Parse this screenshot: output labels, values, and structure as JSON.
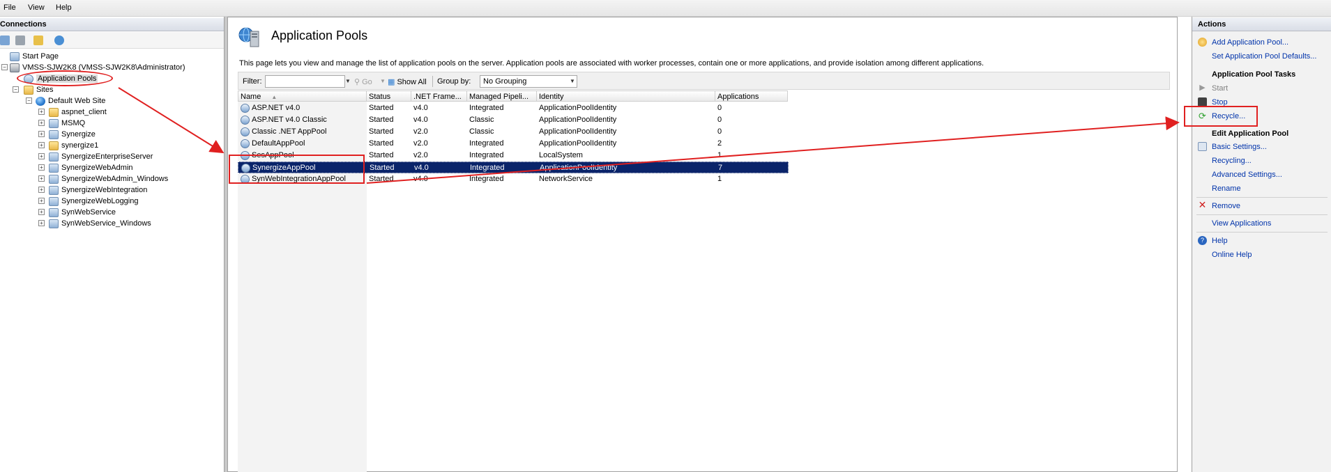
{
  "menubar": {
    "items": [
      "File",
      "View",
      "Help"
    ]
  },
  "connections": {
    "header": "Connections",
    "tree": {
      "start_page": "Start Page",
      "server": "VMSS-SJW2K8 (VMSS-SJW2K8\\Administrator)",
      "application_pools": "Application Pools",
      "sites": "Sites",
      "default_web_site": "Default Web Site",
      "children": [
        "aspnet_client",
        "MSMQ",
        "Synergize",
        "synergize1",
        "SynergizeEnterpriseServer",
        "SynergizeWebAdmin",
        "SynergizeWebAdmin_Windows",
        "SynergizeWebIntegration",
        "SynergizeWebLogging",
        "SynWebService",
        "SynWebService_Windows"
      ]
    }
  },
  "main": {
    "title": "Application Pools",
    "description": "This page lets you view and manage the list of application pools on the server. Application pools are associated with worker processes, contain one or more applications, and provide isolation among different applications.",
    "filter": {
      "label": "Filter:",
      "value": "",
      "go_label": "Go",
      "show_all_label": "Show All",
      "group_by_label": "Group by:",
      "group_by_value": "No Grouping"
    },
    "columns": [
      "Name",
      "Status",
      ".NET Frame...",
      "Managed Pipeli...",
      "Identity",
      "Applications"
    ],
    "rows": [
      {
        "name": "ASP.NET v4.0",
        "status": "Started",
        "net": "v4.0",
        "pipeline": "Integrated",
        "identity": "ApplicationPoolIdentity",
        "apps": "0"
      },
      {
        "name": "ASP.NET v4.0 Classic",
        "status": "Started",
        "net": "v4.0",
        "pipeline": "Classic",
        "identity": "ApplicationPoolIdentity",
        "apps": "0"
      },
      {
        "name": "Classic .NET AppPool",
        "status": "Started",
        "net": "v2.0",
        "pipeline": "Classic",
        "identity": "ApplicationPoolIdentity",
        "apps": "0"
      },
      {
        "name": "DefaultAppPool",
        "status": "Started",
        "net": "v2.0",
        "pipeline": "Integrated",
        "identity": "ApplicationPoolIdentity",
        "apps": "2"
      },
      {
        "name": "SesAppPool",
        "status": "Started",
        "net": "v2.0",
        "pipeline": "Integrated",
        "identity": "LocalSystem",
        "apps": "1"
      },
      {
        "name": "SynergizeAppPool",
        "status": "Started",
        "net": "v4.0",
        "pipeline": "Integrated",
        "identity": "ApplicationPoolIdentity",
        "apps": "7",
        "selected": true
      },
      {
        "name": "SynWebIntegrationAppPool",
        "status": "Started",
        "net": "v4.0",
        "pipeline": "Integrated",
        "identity": "NetworkService",
        "apps": "1"
      }
    ]
  },
  "actions": {
    "header": "Actions",
    "add_pool": "Add Application Pool...",
    "set_defaults": "Set Application Pool Defaults...",
    "tasks_header": "Application Pool Tasks",
    "start": "Start",
    "stop": "Stop",
    "recycle": "Recycle...",
    "edit_header": "Edit Application Pool",
    "basic_settings": "Basic Settings...",
    "recycling": "Recycling...",
    "advanced_settings": "Advanced Settings...",
    "rename": "Rename",
    "remove": "Remove",
    "view_applications": "View Applications",
    "help": "Help",
    "online_help": "Online Help"
  },
  "colors": {
    "selection": "#0a246a",
    "link": "#0033aa",
    "annotation": "#e02020"
  },
  "icons": {
    "tree": [
      "start-page-icon",
      "server-icon",
      "app-pool-icon",
      "sites-icon",
      "globe-icon",
      "folder-icon",
      "web-app-icon"
    ],
    "actions": [
      "add-icon",
      "start-icon",
      "stop-icon",
      "recycle-icon",
      "settings-icon",
      "remove-icon",
      "help-icon"
    ]
  }
}
